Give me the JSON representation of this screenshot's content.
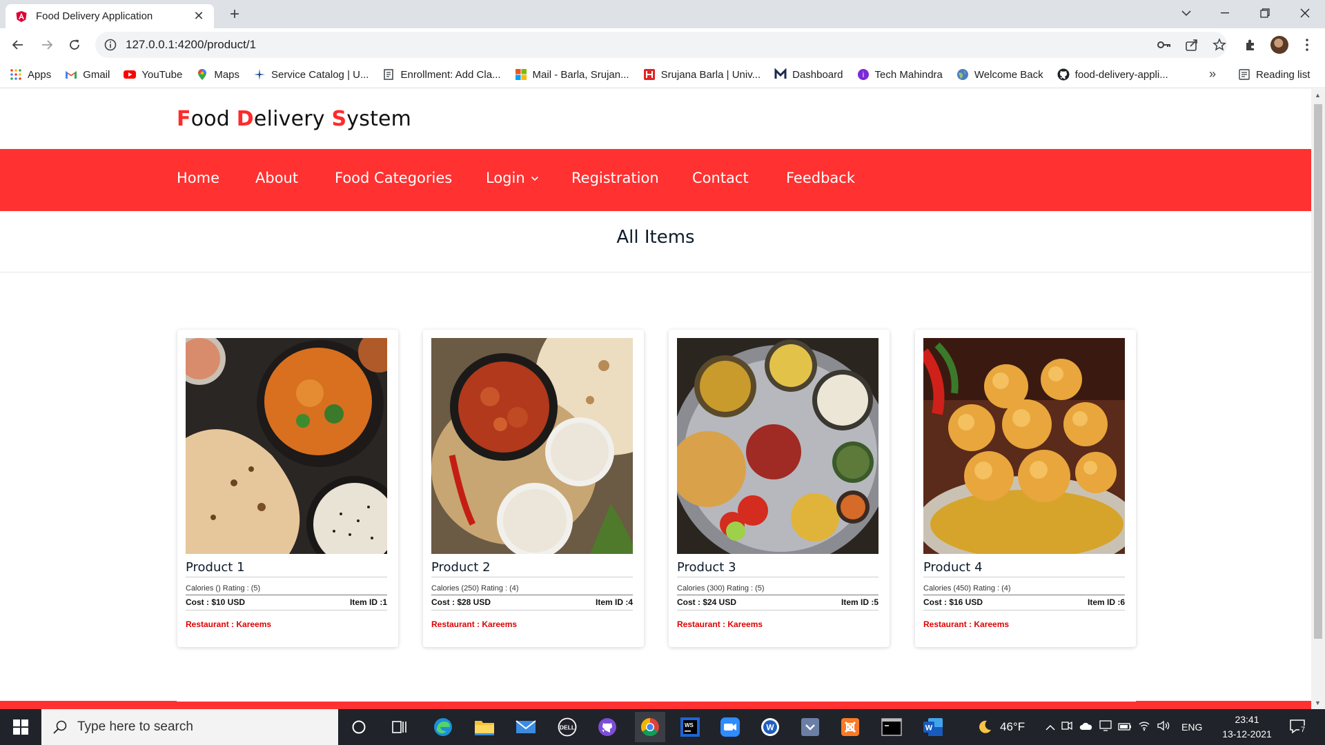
{
  "browser": {
    "tab_title": "Food Delivery Application",
    "url": "127.0.0.1:4200/product/1",
    "bookmarks": [
      {
        "label": "Apps",
        "icon": "apps-grid-icon"
      },
      {
        "label": "Gmail",
        "icon": "gmail-icon"
      },
      {
        "label": "YouTube",
        "icon": "youtube-icon"
      },
      {
        "label": "Maps",
        "icon": "maps-icon"
      },
      {
        "label": "Service Catalog | U...",
        "icon": "service-catalog-icon"
      },
      {
        "label": "Enrollment: Add Cla...",
        "icon": "document-icon"
      },
      {
        "label": "Mail - Barla, Srujan...",
        "icon": "microsoft-icon"
      },
      {
        "label": "Srujana Barla | Univ...",
        "icon": "university-icon"
      },
      {
        "label": "Dashboard",
        "icon": "dashboard-icon"
      },
      {
        "label": "Tech Mahindra",
        "icon": "tech-mahindra-icon"
      },
      {
        "label": "Welcome Back",
        "icon": "globe-icon"
      },
      {
        "label": "food-delivery-appli...",
        "icon": "github-icon"
      }
    ],
    "bookmarks_more": "»",
    "reading_list": "Reading list"
  },
  "site": {
    "brand": {
      "F": "F",
      "ood": "ood ",
      "D": "D",
      "elivery": "elivery ",
      "S": "S",
      "ystem": "ystem"
    },
    "nav": [
      "Home",
      "About",
      "Food Categories",
      "Login",
      "Registration",
      "Contact",
      "Feedback"
    ],
    "section_title": "All Items"
  },
  "products": [
    {
      "name": "Product 1",
      "stats": "Calories () Rating : (5)",
      "cost": "Cost : $10 USD",
      "item_id": "Item ID :1",
      "restaurant": "Restaurant : Kareems",
      "image": "curry-naan-rice"
    },
    {
      "name": "Product 2",
      "stats": "Calories (250) Rating : (4)",
      "cost": "Cost : $28 USD",
      "item_id": "Item ID :4",
      "restaurant": "Restaurant : Kareems",
      "image": "chicken-curry-rice-roti"
    },
    {
      "name": "Product 3",
      "stats": "Calories (300) Rating : (5)",
      "cost": "Cost : $24 USD",
      "item_id": "Item ID :5",
      "restaurant": "Restaurant : Kareems",
      "image": "thali-platter"
    },
    {
      "name": "Product 4",
      "stats": "Calories (450) Rating : (4)",
      "cost": "Cost : $16 USD",
      "item_id": "Item ID :6",
      "restaurant": "Restaurant : Kareems",
      "image": "sweet-dumplings"
    }
  ],
  "taskbar": {
    "search_placeholder": "Type here to search",
    "weather": "46°F",
    "language": "ENG",
    "time": "23:41",
    "date": "13-12-2021",
    "notification_count": "7"
  },
  "colors": {
    "brand_red": "#ff3131",
    "text_dark": "#0d1b2a",
    "restaurant_red": "#e00000"
  }
}
